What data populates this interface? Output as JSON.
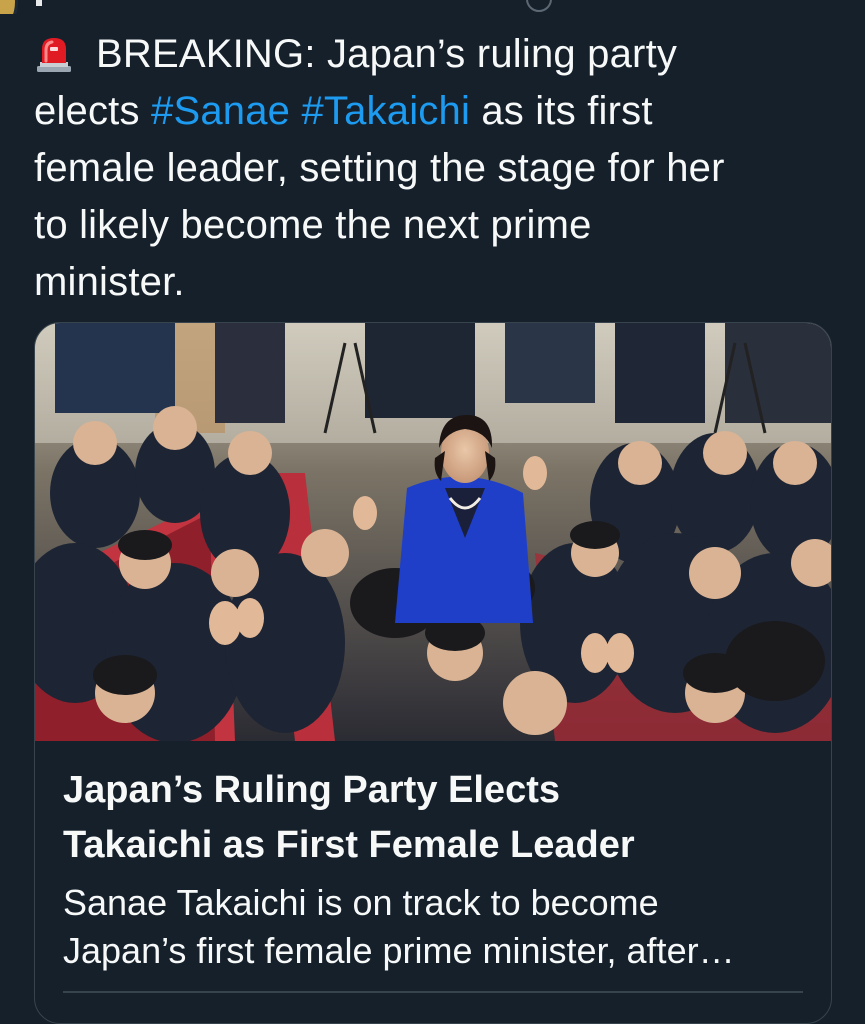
{
  "tweet": {
    "emoji_icon": "police-car-light-icon",
    "text_lines": [
      {
        "before": "BREAKING: Japan’s ruling party"
      },
      {
        "before": "elects ",
        "hashtag1": "#Sanae",
        "space": " ",
        "hashtag2": "#Takaichi",
        "after": " as its first"
      },
      {
        "before": "female leader, setting the stage for her"
      },
      {
        "before": "to likely become the next prime"
      },
      {
        "before": "minister."
      }
    ]
  },
  "card": {
    "title_lines": [
      "Japan’s Ruling Party Elects",
      "Takaichi as First Female Leader"
    ],
    "description_lines": [
      "Sanae Takaichi is on track to become",
      "Japan’s first female prime minister, after…"
    ]
  },
  "colors": {
    "background": "#15202b",
    "text": "#f7f9f9",
    "hashtag": "#1d9bf0",
    "card_border": "#38444d"
  }
}
